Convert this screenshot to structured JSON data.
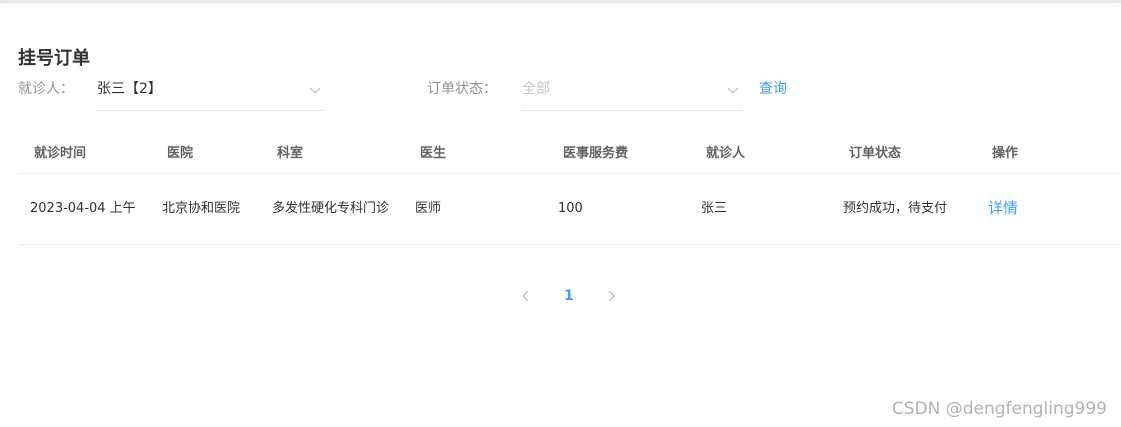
{
  "page": {
    "title": "挂号订单"
  },
  "filters": {
    "patient": {
      "label": "就诊人：",
      "value": "张三【2】"
    },
    "status": {
      "label": "订单状态：",
      "placeholder": "全部"
    },
    "query_label": "查询"
  },
  "table": {
    "headers": [
      "就诊时间",
      "医院",
      "科室",
      "医生",
      "医事服务费",
      "就诊人",
      "订单状态",
      "操作"
    ],
    "rows": [
      {
        "time": "2023-04-04 上午",
        "hospital": "北京协和医院",
        "department": "多发性硬化专科门诊",
        "doctor": "医师",
        "fee": "100",
        "patient": "张三",
        "status": "预约成功，待支付",
        "action": "详情"
      }
    ]
  },
  "pagination": {
    "current": "1"
  },
  "watermark": "CSDN @dengfengling999",
  "colors": {
    "accent": "#409eff",
    "border": "#ebeef5",
    "label": "#909399"
  }
}
